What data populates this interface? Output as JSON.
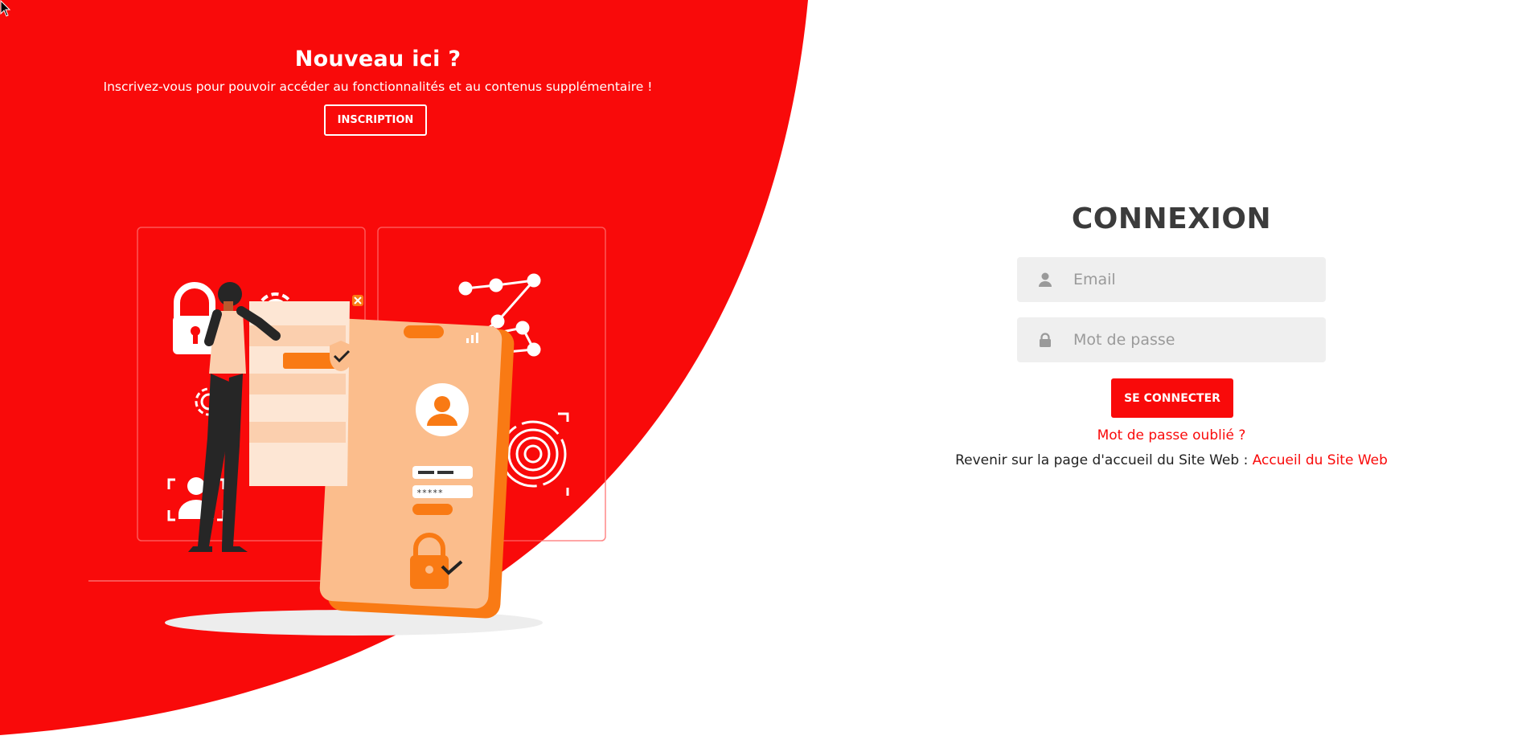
{
  "colors": {
    "accent": "#f90a0a",
    "title_text": "#3b3b3b",
    "field_bg": "#efefef"
  },
  "signup": {
    "title": "Nouveau ici ?",
    "subtitle": "Inscrivez-vous pour pouvoir accéder au fonctionnalités et au contenus supplémentaire !",
    "button_label": "INSCRIPTION"
  },
  "login": {
    "title": "CONNEXION",
    "email_placeholder": "Email",
    "email_value": "",
    "email_icon": "user-icon",
    "password_placeholder": "Mot de passe",
    "password_value": "",
    "password_icon": "lock-icon",
    "submit_label": "SE CONNECTER",
    "forgot_link": "Mot de passe oublié ?",
    "back_text": "Revenir sur la page d'accueil du Site Web : ",
    "back_link": "Accueil du Site Web"
  },
  "illustration": {
    "password_mask": "*****"
  }
}
